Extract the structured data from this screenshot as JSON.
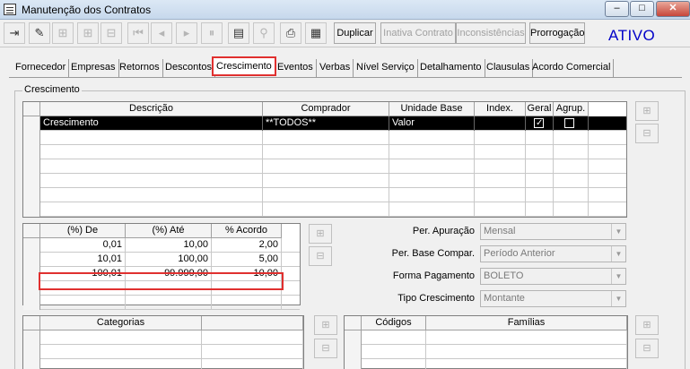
{
  "window": {
    "title": "Manutenção dos Contratos",
    "min": "–",
    "max": "□",
    "close": "✕"
  },
  "toolbar": {
    "icons": [
      {
        "name": "exit-icon",
        "glyph": "⇥",
        "disabled": false
      },
      {
        "name": "edit-icon",
        "glyph": "✎",
        "disabled": false
      },
      {
        "name": "insert-row-icon",
        "glyph": "⊞",
        "disabled": true
      },
      {
        "name": "insert-after-icon",
        "glyph": "⊞",
        "disabled": true
      },
      {
        "name": "delete-row-icon",
        "glyph": "⊟",
        "disabled": true
      },
      {
        "name": "first-record-icon",
        "glyph": "⏮",
        "disabled": true
      },
      {
        "name": "prev-record-icon",
        "glyph": "◂",
        "disabled": true
      },
      {
        "name": "next-record-icon",
        "glyph": "▸",
        "disabled": true
      },
      {
        "name": "pause-icon",
        "glyph": "⏸",
        "disabled": true
      },
      {
        "name": "list-icon",
        "glyph": "▤",
        "disabled": false
      },
      {
        "name": "binoculars-icon",
        "glyph": "⚲",
        "disabled": true
      },
      {
        "name": "print-icon",
        "glyph": "⎙",
        "disabled": false
      },
      {
        "name": "calendar-icon",
        "glyph": "▦",
        "disabled": false
      }
    ],
    "buttons": [
      {
        "name": "duplicar-button",
        "label": "Duplicar",
        "disabled": false
      },
      {
        "name": "inativa-contrato-button",
        "label": "Inativa Contrato",
        "disabled": true
      },
      {
        "name": "inconsistencias-button",
        "label": "Inconsistências",
        "disabled": true
      },
      {
        "name": "prorrogacao-button",
        "label": "Prorrogação",
        "disabled": false
      }
    ],
    "status": "ATIVO"
  },
  "tabs": [
    "Fornecedor",
    "Empresas",
    "Retornos",
    "Descontos",
    "Crescimento",
    "Eventos",
    "Verbas",
    "Nível Serviço",
    "Detalhamento",
    "Clausulas",
    "Acordo Comercial"
  ],
  "active_tab": "Crescimento",
  "group_title": "Crescimento",
  "main_grid": {
    "headers": [
      "Descrição",
      "Comprador",
      "Unidade Base",
      "Index.",
      "Geral",
      "Agrup."
    ],
    "rows": [
      {
        "descricao": "Crescimento",
        "comprador": "**TODOS**",
        "unidade": "Valor",
        "index": "",
        "geral": true,
        "agrup": false
      }
    ]
  },
  "range_grid": {
    "headers": [
      "(%) De",
      "(%) Até",
      "% Acordo"
    ],
    "rows": [
      {
        "de": "0,01",
        "ate": "10,00",
        "acordo": "2,00"
      },
      {
        "de": "10,01",
        "ate": "100,00",
        "acordo": "5,00"
      },
      {
        "de": "100,01",
        "ate": "99.999,00",
        "acordo": "10,00"
      }
    ]
  },
  "fields": [
    {
      "label": "Per. Apuração",
      "value": "Mensal"
    },
    {
      "label": "Per. Base Compar.",
      "value": "Período Anterior"
    },
    {
      "label": "Forma Pagamento",
      "value": "BOLETO"
    },
    {
      "label": "Tipo Crescimento",
      "value": "Montante"
    }
  ],
  "categorias_grid": {
    "headers": [
      "Categorias"
    ]
  },
  "codigos_grid": {
    "headers": [
      "Códigos",
      "Famílias"
    ]
  }
}
